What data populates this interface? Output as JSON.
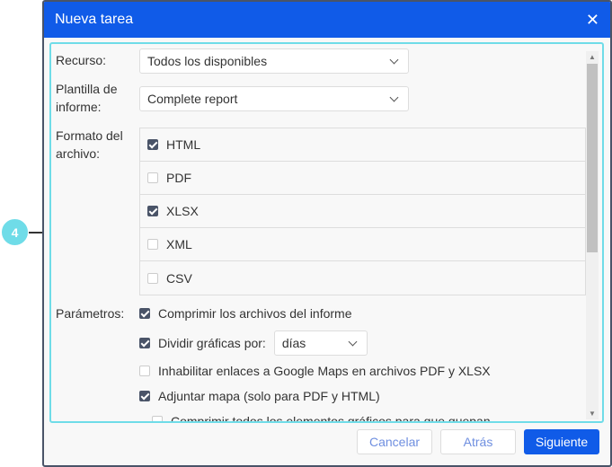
{
  "dialog": {
    "title": "Nueva tarea"
  },
  "form": {
    "resource_label": "Recurso:",
    "resource_value": "Todos los disponibles",
    "template_label_1": "Plantilla de",
    "template_label_2": "informe:",
    "template_value": "Complete report",
    "format_label_1": "Formato del",
    "format_label_2": "archivo:",
    "formats": [
      {
        "label": "HTML",
        "checked": true
      },
      {
        "label": "PDF",
        "checked": false
      },
      {
        "label": "XLSX",
        "checked": true
      },
      {
        "label": "XML",
        "checked": false
      },
      {
        "label": "CSV",
        "checked": false
      }
    ],
    "params_label": "Parámetros:",
    "params": {
      "compress": "Comprimir los archivos del informe",
      "split": "Dividir gráficas por:",
      "split_value": "días",
      "disable_links": "Inhabilitar enlaces a Google Maps en archivos PDF y XLSX",
      "attach_map": "Adjuntar mapa (solo para PDF y HTML)",
      "fit_all": "Comprimir todos los elementos gráficos para que quepan"
    }
  },
  "footer": {
    "cancel": "Cancelar",
    "back": "Atrás",
    "next": "Siguiente"
  },
  "callout": {
    "number": "4"
  }
}
